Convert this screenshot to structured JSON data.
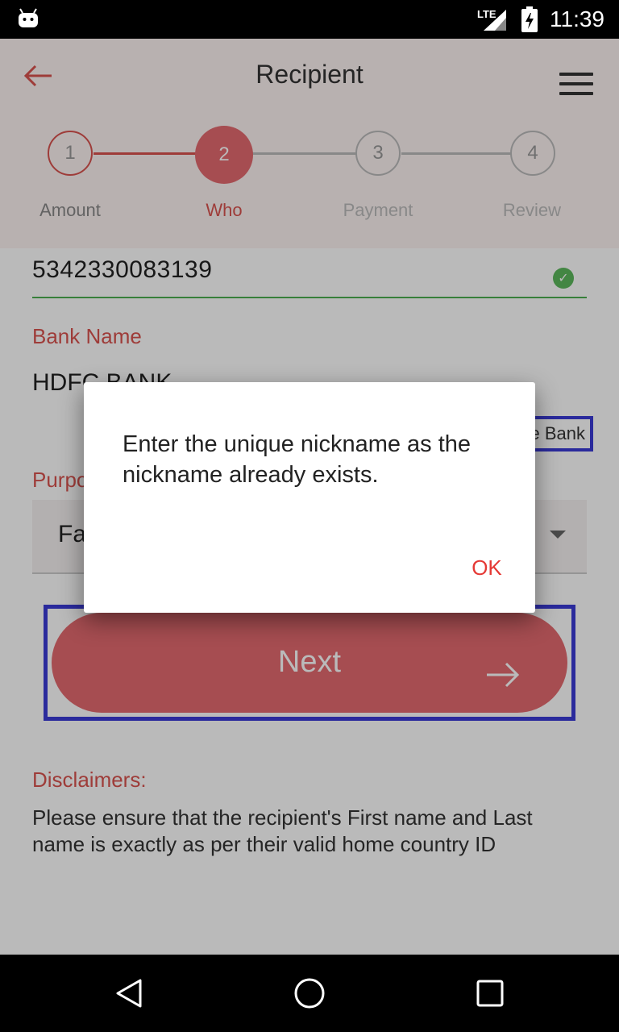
{
  "status_bar": {
    "network": "LTE",
    "time": "11:39"
  },
  "header": {
    "title": "Recipient",
    "steps": [
      {
        "number": "1",
        "label": "Amount"
      },
      {
        "number": "2",
        "label": "Who"
      },
      {
        "number": "3",
        "label": "Payment"
      },
      {
        "number": "4",
        "label": "Review"
      }
    ],
    "active_step": 2
  },
  "form": {
    "account_number": "5342330083139",
    "bank_name_label": "Bank Name",
    "bank_name_value": "HDFC BANK",
    "change_bank_label": "Change Bank",
    "purpose_label": "Purpose",
    "purpose_value": "Family"
  },
  "next_button": {
    "label": "Next"
  },
  "disclaimers": {
    "title": "Disclaimers:",
    "text": "Please ensure that the recipient's First name and Last name is exactly as per their valid home country ID"
  },
  "dialog": {
    "message": "Enter the unique nickname as the nickname already exists.",
    "ok_label": "OK"
  },
  "colors": {
    "accent": "#d9534f",
    "header_bg": "#fdf3f2",
    "button": "#e46a6f",
    "highlight_border": "#3a3ad6",
    "success": "#4caf50"
  },
  "icons": [
    "android-icon",
    "signal-icon",
    "battery-icon",
    "back-arrow-icon",
    "menu-icon",
    "check-icon",
    "dropdown-caret-icon",
    "arrow-right-icon",
    "nav-back-icon",
    "nav-home-icon",
    "nav-recents-icon"
  ]
}
